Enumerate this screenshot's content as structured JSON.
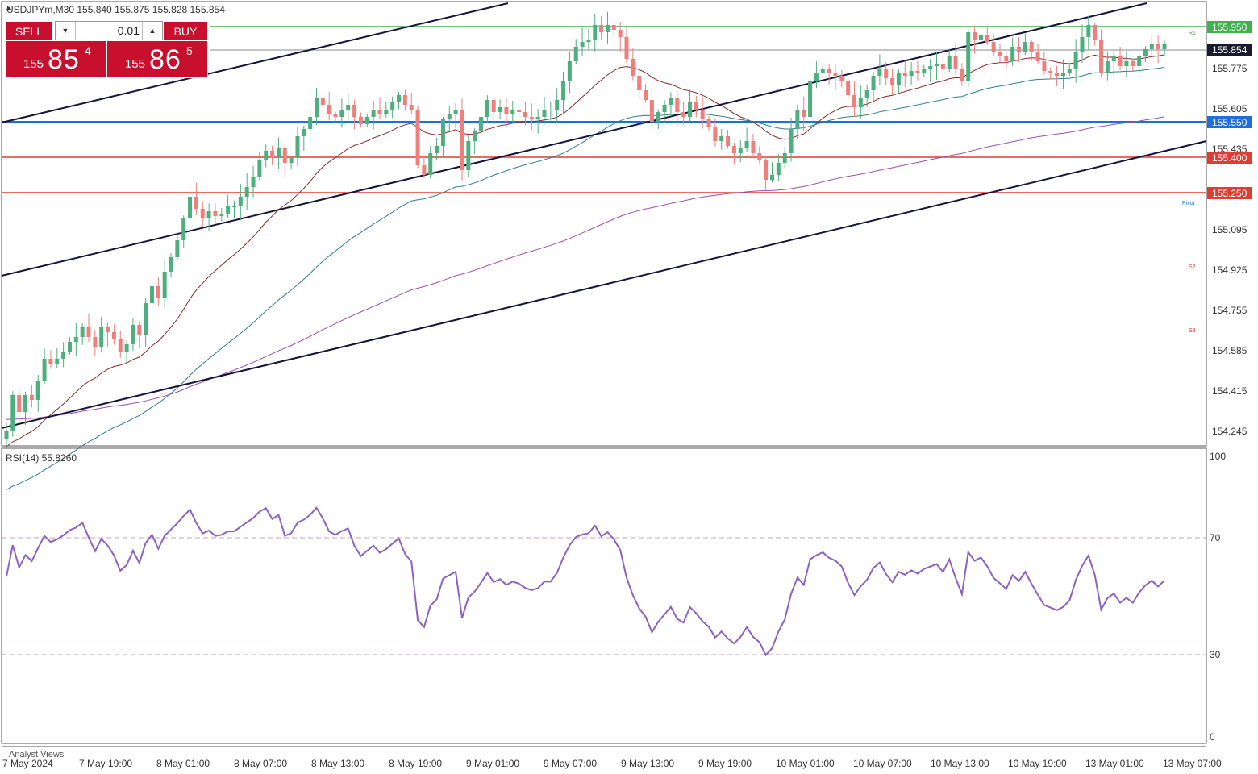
{
  "symbol_header": "USDJPYm,M30  155.840 155.875 155.828 155.854",
  "trade_panel": {
    "sell_label": "SELL",
    "buy_label": "BUY",
    "lot_value": "0.01",
    "sell_price_small": "155",
    "sell_price_big": "85",
    "sell_price_sup": "4",
    "buy_price_small": "155",
    "buy_price_big": "86",
    "buy_price_sup": "5"
  },
  "price_axis": {
    "ticks": [
      "155.775",
      "155.605",
      "155.435",
      "155.095",
      "154.925",
      "154.755",
      "154.585",
      "154.415",
      "154.245"
    ]
  },
  "price_labels": [
    {
      "name": "resistance-label",
      "text": "155.950",
      "color": "#3cb44b",
      "value": 155.95
    },
    {
      "name": "current-price-label",
      "text": "155.854",
      "color": "#1a1a2e",
      "value": 155.854
    },
    {
      "name": "support-blue-label",
      "text": "155.550",
      "color": "#1e6fd9",
      "value": 155.55
    },
    {
      "name": "support-red-1-label",
      "text": "155.400",
      "color": "#e03c31",
      "value": 155.4
    },
    {
      "name": "support-red-2-label",
      "text": "155.250",
      "color": "#e03c31",
      "value": 155.25
    }
  ],
  "level_markers": [
    {
      "name": "r1-marker",
      "text": "R1",
      "value": 155.93,
      "color": "#3cb44b"
    },
    {
      "name": "pivot-marker",
      "text": "Pivot",
      "value": 155.21,
      "color": "#1e6fd9"
    },
    {
      "name": "s2-marker",
      "text": "S2",
      "value": 154.94,
      "color": "#e03c31"
    },
    {
      "name": "s3-marker",
      "text": "S3",
      "value": 154.68,
      "color": "#e03c31"
    }
  ],
  "rsi": {
    "label": "RSI(14) 55.8260",
    "levels": [
      "100",
      "70",
      "30",
      "0"
    ]
  },
  "time_axis": {
    "labels": [
      "7 May 2024",
      "7 May 19:00",
      "8 May 01:00",
      "8 May 07:00",
      "8 May 13:00",
      "8 May 19:00",
      "9 May 01:00",
      "9 May 07:00",
      "9 May 13:00",
      "9 May 19:00",
      "10 May 01:00",
      "10 May 07:00",
      "10 May 13:00",
      "10 May 19:00",
      "13 May 01:00",
      "13 May 07:00"
    ]
  },
  "footer_label": "Analyst Views",
  "colors": {
    "bull": "#4caf7d",
    "bear": "#ef7f7a",
    "ma_fast": "#8b2a2a",
    "ma_mid": "#2f7f8f",
    "ma_slow": "#9b4fb0",
    "channel": "#14143c",
    "rsi_line": "#8a63c4"
  },
  "chart_data": {
    "type": "candlestick",
    "timeframe": "M30",
    "ylim": [
      154.2,
      156.02
    ],
    "close_series": [
      154.25,
      154.4,
      154.33,
      154.4,
      154.38,
      154.46,
      154.55,
      154.53,
      154.55,
      154.58,
      154.62,
      154.64,
      154.68,
      154.64,
      154.6,
      154.68,
      154.66,
      154.63,
      154.58,
      154.61,
      154.69,
      154.65,
      154.78,
      154.85,
      154.8,
      154.91,
      154.97,
      155.04,
      155.13,
      155.22,
      155.17,
      155.13,
      155.16,
      155.14,
      155.15,
      155.18,
      155.18,
      155.22,
      155.26,
      155.3,
      155.37,
      155.41,
      155.38,
      155.42,
      155.36,
      155.38,
      155.47,
      155.5,
      155.55,
      155.63,
      155.6,
      155.56,
      155.55,
      155.58,
      155.6,
      155.55,
      155.52,
      155.55,
      155.58,
      155.56,
      155.58,
      155.61,
      155.64,
      155.6,
      155.58,
      155.35,
      155.31,
      155.4,
      155.43,
      155.54,
      155.56,
      155.58,
      155.33,
      155.45,
      155.49,
      155.55,
      155.62,
      155.57,
      155.59,
      155.56,
      155.58,
      155.57,
      155.55,
      155.54,
      155.55,
      155.58,
      155.58,
      155.62,
      155.7,
      155.78,
      155.84,
      155.86,
      155.87,
      155.93,
      155.9,
      155.93,
      155.91,
      155.88,
      155.79,
      155.72,
      155.66,
      155.62,
      155.53,
      155.57,
      155.6,
      155.63,
      155.57,
      155.55,
      155.61,
      155.58,
      155.54,
      155.51,
      155.45,
      155.47,
      155.43,
      155.4,
      155.42,
      155.45,
      155.4,
      155.37,
      155.29,
      155.31,
      155.36,
      155.4,
      155.5,
      155.58,
      155.55,
      155.7,
      155.73,
      155.75,
      155.73,
      155.72,
      155.7,
      155.64,
      155.59,
      155.63,
      155.66,
      155.72,
      155.75,
      155.71,
      155.68,
      155.73,
      155.72,
      155.74,
      155.73,
      155.75,
      155.76,
      155.77,
      155.75,
      155.8,
      155.75,
      155.7,
      155.9,
      155.87,
      155.89,
      155.86,
      155.82,
      155.8,
      155.78,
      155.84,
      155.82,
      155.86,
      155.82,
      155.78,
      155.74,
      155.73,
      155.72,
      155.73,
      155.75,
      155.82,
      155.88,
      155.93,
      155.87,
      155.73,
      155.78,
      155.8,
      155.76,
      155.78,
      155.76,
      155.8,
      155.83,
      155.85,
      155.83,
      155.854
    ]
  }
}
